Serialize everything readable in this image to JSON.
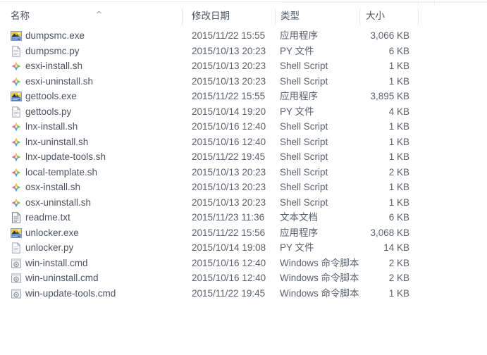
{
  "window": {
    "view": "details-list",
    "sort_column": "名称",
    "sort_direction": "ascending",
    "sort_caret_glyph": "^"
  },
  "columns": [
    {
      "key": "name",
      "label": "名称"
    },
    {
      "key": "date",
      "label": "修改日期"
    },
    {
      "key": "type",
      "label": "类型"
    },
    {
      "key": "size",
      "label": "大小"
    }
  ],
  "type_colors": {
    "exe_gold": "#f5c518",
    "exe_blue": "#4a76b8",
    "sh_pink": "#e8619d",
    "sh_yellow": "#f2c43d",
    "sh_green": "#7ac143",
    "sh_blue": "#45a8e0",
    "doc_outline": "#9aa3ad",
    "cmd_gray": "#9aa1a9",
    "text_color": "#4b5461",
    "header_text": "#4a5360",
    "separator": "#e4e7ea"
  },
  "rows": [
    {
      "icon": "application-exe-icon",
      "name": "dumpsmc.exe",
      "date": "2015/11/22 15:55",
      "type": "应用程序",
      "size": "3,066 KB"
    },
    {
      "icon": "python-file-icon",
      "name": "dumpsmc.py",
      "date": "2015/10/13 20:23",
      "type": "PY 文件",
      "size": "6 KB"
    },
    {
      "icon": "shell-script-icon",
      "name": "esxi-install.sh",
      "date": "2015/10/13 20:23",
      "type": "Shell Script",
      "size": "1 KB"
    },
    {
      "icon": "shell-script-icon",
      "name": "esxi-uninstall.sh",
      "date": "2015/10/13 20:23",
      "type": "Shell Script",
      "size": "1 KB"
    },
    {
      "icon": "application-exe-icon",
      "name": "gettools.exe",
      "date": "2015/11/22 15:55",
      "type": "应用程序",
      "size": "3,895 KB"
    },
    {
      "icon": "python-file-icon",
      "name": "gettools.py",
      "date": "2015/10/14 19:20",
      "type": "PY 文件",
      "size": "4 KB"
    },
    {
      "icon": "shell-script-icon",
      "name": "lnx-install.sh",
      "date": "2015/10/16 12:40",
      "type": "Shell Script",
      "size": "1 KB"
    },
    {
      "icon": "shell-script-icon",
      "name": "lnx-uninstall.sh",
      "date": "2015/10/16 12:40",
      "type": "Shell Script",
      "size": "1 KB"
    },
    {
      "icon": "shell-script-icon",
      "name": "lnx-update-tools.sh",
      "date": "2015/11/22 19:45",
      "type": "Shell Script",
      "size": "1 KB"
    },
    {
      "icon": "shell-script-icon",
      "name": "local-template.sh",
      "date": "2015/10/13 20:23",
      "type": "Shell Script",
      "size": "2 KB"
    },
    {
      "icon": "shell-script-icon",
      "name": "osx-install.sh",
      "date": "2015/10/13 20:23",
      "type": "Shell Script",
      "size": "1 KB"
    },
    {
      "icon": "shell-script-icon",
      "name": "osx-uninstall.sh",
      "date": "2015/10/13 20:23",
      "type": "Shell Script",
      "size": "1 KB"
    },
    {
      "icon": "text-document-icon",
      "name": "readme.txt",
      "date": "2015/11/23 11:36",
      "type": "文本文档",
      "size": "6 KB"
    },
    {
      "icon": "application-exe-icon",
      "name": "unlocker.exe",
      "date": "2015/11/22 15:56",
      "type": "应用程序",
      "size": "3,068 KB"
    },
    {
      "icon": "python-file-icon",
      "name": "unlocker.py",
      "date": "2015/10/14 19:08",
      "type": "PY 文件",
      "size": "14 KB"
    },
    {
      "icon": "command-script-icon",
      "name": "win-install.cmd",
      "date": "2015/10/16 12:40",
      "type": "Windows 命令脚本",
      "size": "2 KB"
    },
    {
      "icon": "command-script-icon",
      "name": "win-uninstall.cmd",
      "date": "2015/10/16 12:40",
      "type": "Windows 命令脚本",
      "size": "2 KB"
    },
    {
      "icon": "command-script-icon",
      "name": "win-update-tools.cmd",
      "date": "2015/11/22 19:45",
      "type": "Windows 命令脚本",
      "size": "1 KB"
    }
  ]
}
